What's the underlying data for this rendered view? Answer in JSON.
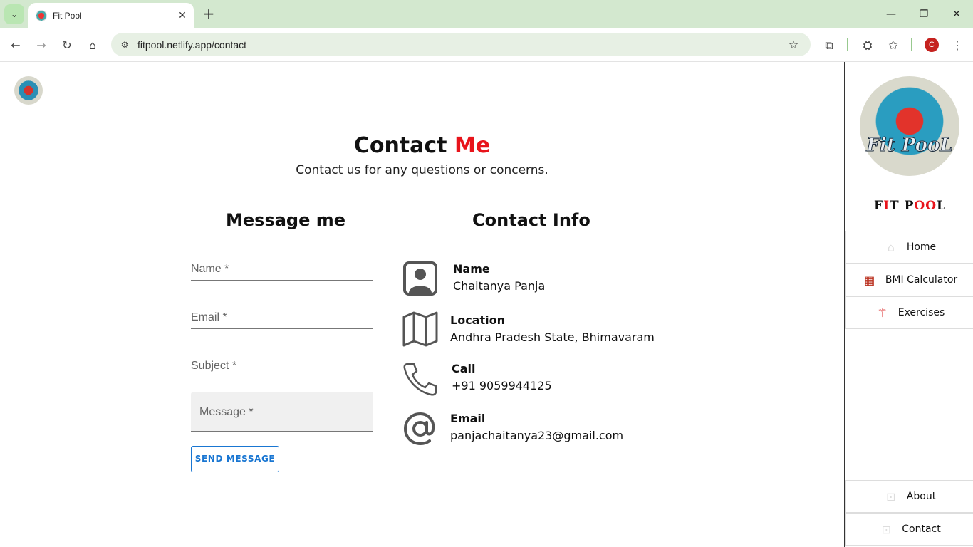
{
  "browser": {
    "tab_title": "Fit Pool",
    "url": "fitpool.netlify.app/contact",
    "profile_initial": "C"
  },
  "page": {
    "heading_main": "Contact",
    "heading_accent": "Me",
    "subheading": "Contact us for any questions or concerns.",
    "form_title": "Message me",
    "info_title": "Contact Info",
    "form": {
      "name_placeholder": "Name *",
      "email_placeholder": "Email *",
      "subject_placeholder": "Subject *",
      "message_placeholder": "Message *",
      "send_label": "SEND MESSAGE"
    },
    "contact": [
      {
        "label": "Name",
        "value": "Chaitanya Panja",
        "icon": "person-icon"
      },
      {
        "label": "Location",
        "value": "Andhra Pradesh State, Bhimavaram",
        "icon": "map-icon"
      },
      {
        "label": "Call",
        "value": "+91 9059944125",
        "icon": "phone-icon"
      },
      {
        "label": "Email",
        "value": "panjachaitanya23@gmail.com",
        "icon": "at-icon"
      }
    ]
  },
  "sidebar": {
    "logo_text": "Fit PooL",
    "brand_letters": [
      "F",
      "I",
      "T",
      " ",
      "P",
      "O",
      "O",
      "L"
    ],
    "nav": [
      {
        "label": "Home",
        "icon": "home-icon"
      },
      {
        "label": "BMI Calculator",
        "icon": "calculator-icon"
      },
      {
        "label": "Exercises",
        "icon": "dumbbell-icon"
      }
    ],
    "bottom_nav": [
      {
        "label": "About",
        "icon": "lock-icon"
      },
      {
        "label": "Contact",
        "icon": "lock-icon"
      }
    ]
  },
  "colors": {
    "accent_red": "#e8141b",
    "button_blue": "#1976d2",
    "chrome_green": "#d3e8cf"
  }
}
